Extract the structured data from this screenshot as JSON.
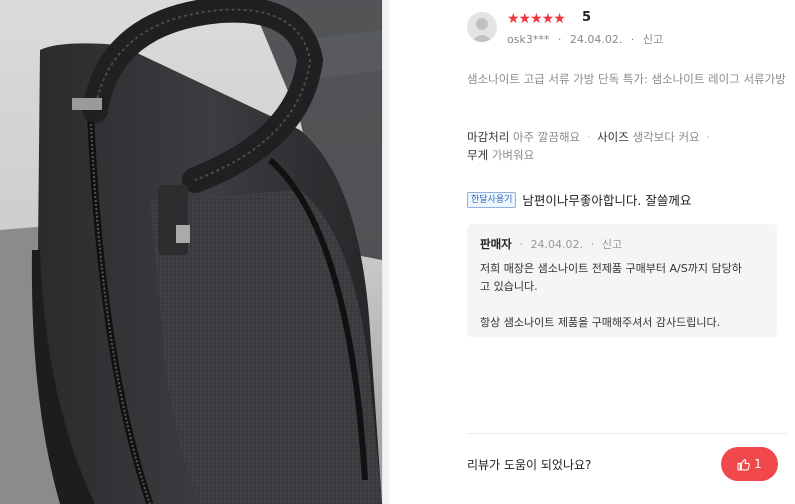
{
  "review": {
    "stars": "★★★★★",
    "score": "5",
    "user": "osk3***",
    "date": "24.04.02.",
    "report": "신고",
    "option_text": "샘소나이트 고급 서류 가방 단독 특가: 샘소나이트 레이그 서류가방",
    "attributes": [
      {
        "label": "마감처리",
        "value": "아주 깔끔해요"
      },
      {
        "label": "사이즈",
        "value": "생각보다 커요"
      },
      {
        "label": "무게",
        "value": "가벼워요"
      }
    ],
    "badge": "한달사용기",
    "body": "남편이나무좋아합니다. 잘쓸께요"
  },
  "reply": {
    "author": "판매자",
    "date": "24.04.02.",
    "report": "신고",
    "line1": "저희 매장은 샘소나이트 전제품 구매부터 A/S까지 담당하",
    "line2": "고 있습니다.",
    "line3": "항상 샘소나이트 제품을 구매해주셔서 감사드립니다."
  },
  "helpful": {
    "question": "리뷰가 도움이 되었나요?",
    "count": "1"
  },
  "colors": {
    "star": "#f2343f",
    "like_button": "#f0484b",
    "badge_blue": "#2f6fbf"
  },
  "icons": {
    "avatar": "default-user-avatar",
    "like": "thumbs-up-icon"
  }
}
